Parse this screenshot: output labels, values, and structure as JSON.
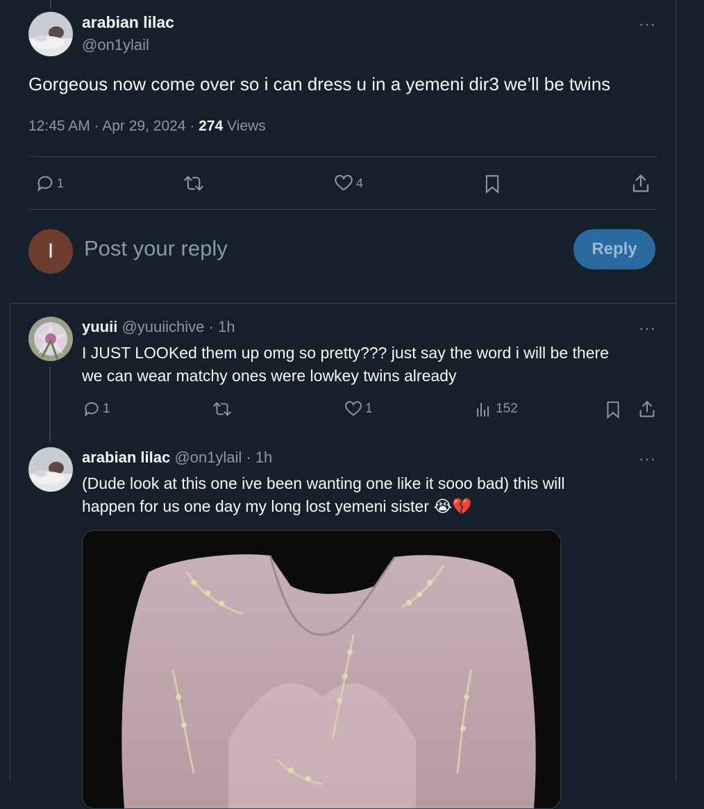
{
  "main_tweet": {
    "display_name": "arabian lilac",
    "handle": "@on1ylail",
    "text": "Gorgeous now come over so i can dress u in a yemeni dir3 we’ll be twins",
    "timestamp": "12:45 AM · Apr 29, 2024 · ",
    "views_count": "274",
    "views_label": " Views",
    "actions": {
      "reply_count": "1",
      "retweet_count": "",
      "like_count": "4"
    }
  },
  "composer": {
    "avatar_letter": "I",
    "placeholder": "Post your reply",
    "button_label": "Reply"
  },
  "replies": [
    {
      "display_name": "yuuii",
      "handle": "@yuuiichive",
      "time": " · 1h",
      "text_line1": "I JUST LOOKed them up omg so pretty??? just say the word i will be there",
      "text_line2": "we can wear matchy ones were lowkey twins already",
      "actions": {
        "reply_count": "1",
        "retweet_count": "",
        "like_count": "1",
        "views_count": "152"
      }
    },
    {
      "display_name": "arabian lilac",
      "handle": "@on1ylail",
      "time": " · 1h",
      "text_line1": "(Dude look at this one ive been wanting one like it sooo bad) this will",
      "text_line2": "happen for us one day  my long lost yemeni sister",
      "emojis": "😭💔"
    }
  ],
  "colors": {
    "background": "#15202b",
    "border": "#38444d",
    "muted_text": "#8b98a5",
    "reply_button": "#2a6aa0",
    "composer_avatar": "#6e3d2f"
  },
  "icons": [
    "more-icon",
    "reply-icon",
    "retweet-icon",
    "like-icon",
    "bookmark-icon",
    "share-icon",
    "views-icon"
  ]
}
